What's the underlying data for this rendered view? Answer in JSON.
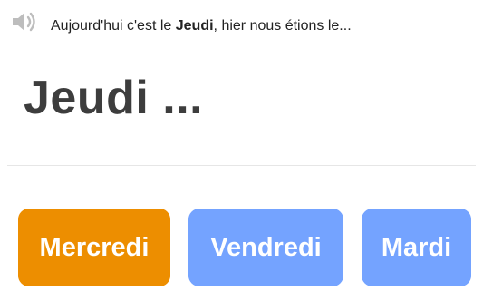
{
  "audio": {
    "icon": "speaker-icon"
  },
  "prompt": {
    "prefix": "Aujourd'hui c'est le ",
    "emphasis": "Jeudi",
    "suffix": ", hier nous étions le..."
  },
  "question": {
    "text": "Jeudi ..."
  },
  "choices": [
    {
      "label": "Mercredi",
      "color": "#ed8e00"
    },
    {
      "label": "Vendredi",
      "color": "#74a3ff"
    },
    {
      "label": "Mardi",
      "color": "#74a3ff"
    }
  ],
  "colors": {
    "icon": "#bdbdbd",
    "text": "#222222",
    "heading": "#3d3d3d",
    "divider": "#e6e6e6"
  }
}
